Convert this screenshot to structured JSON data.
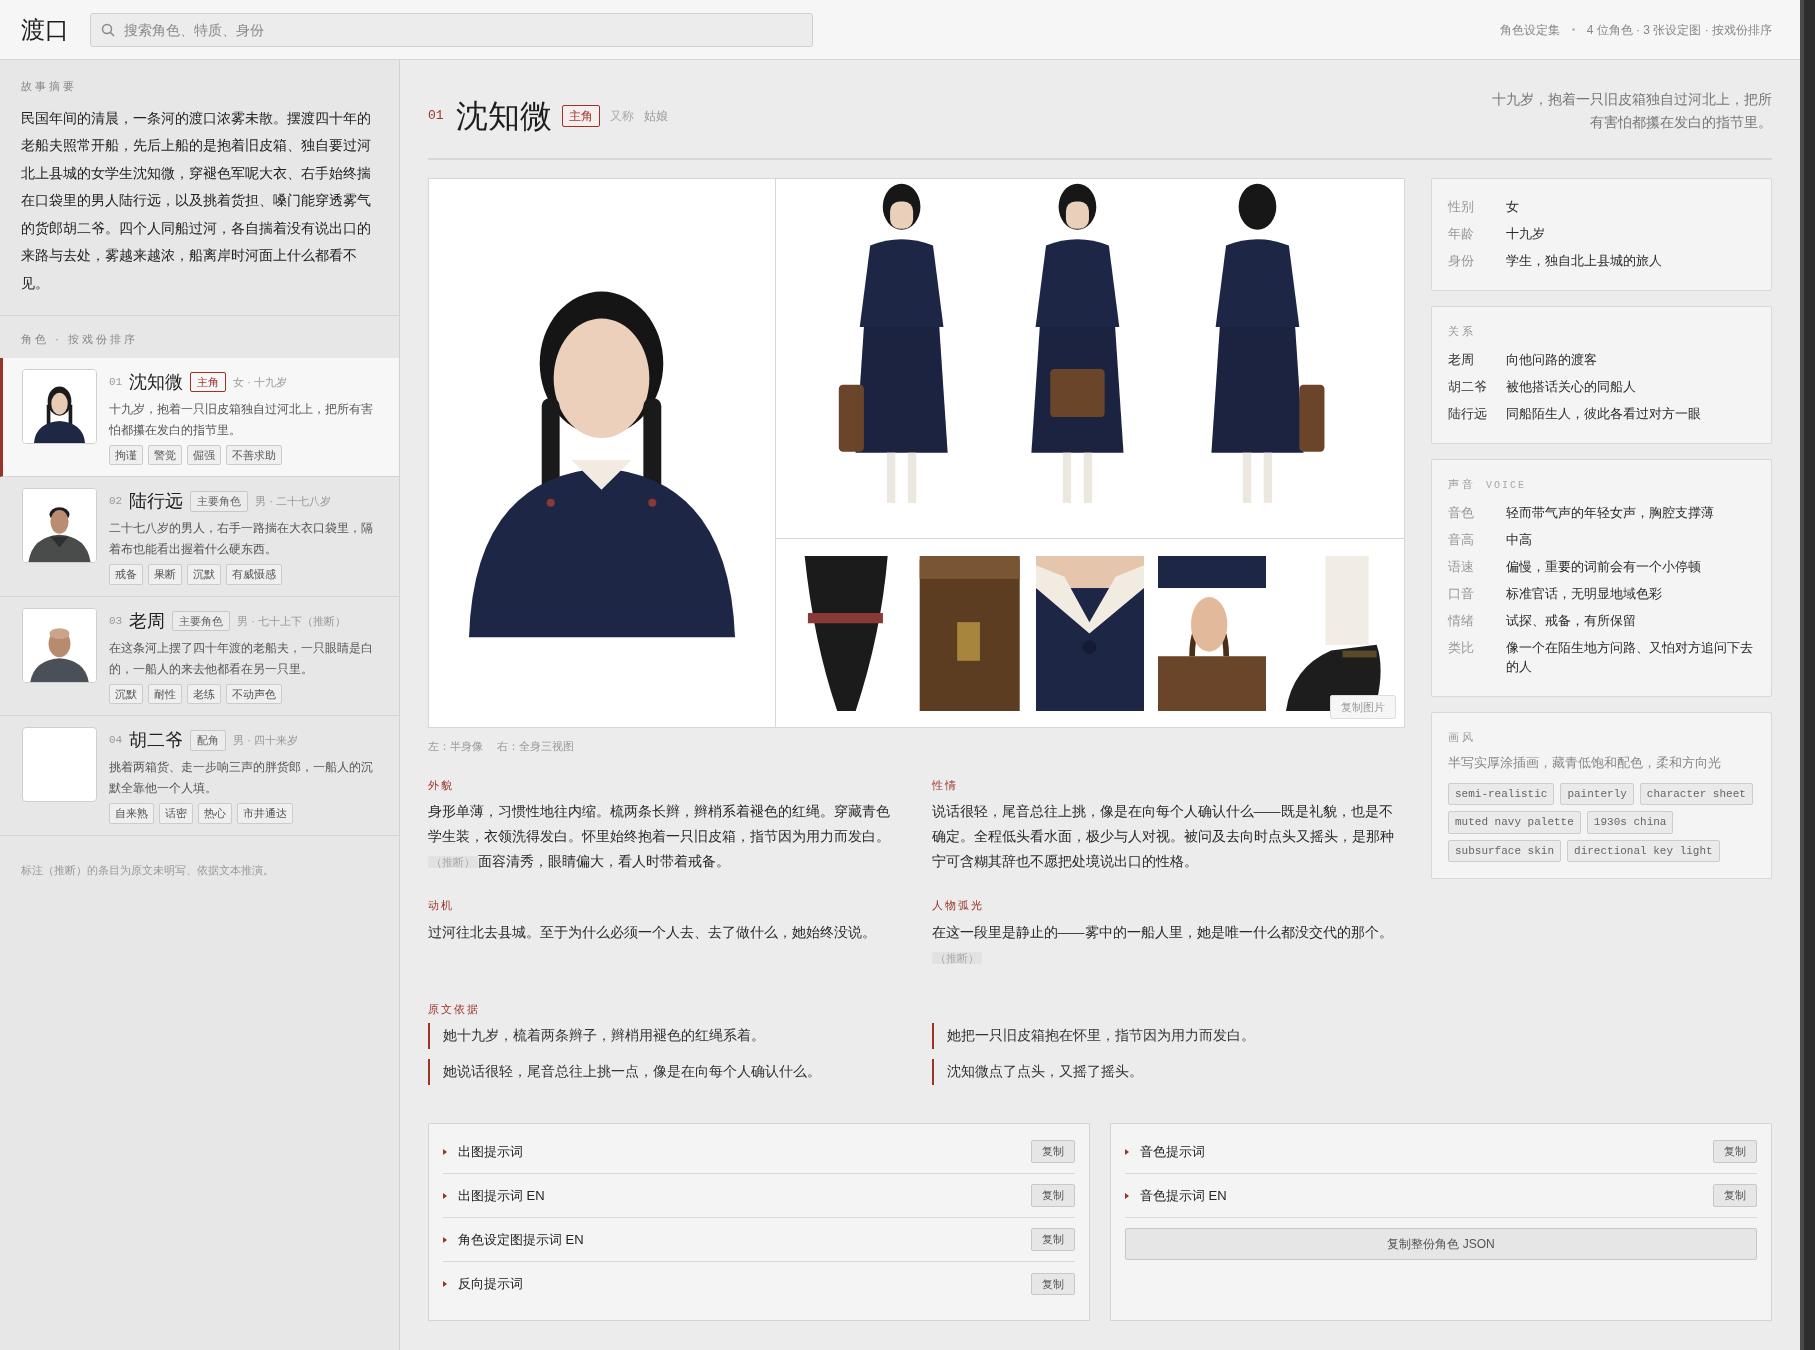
{
  "app": {
    "title": "渡口",
    "search": {
      "placeholder": "搜索角色、特质、身份"
    },
    "collection": "角色设定集",
    "meta": "4 位角色 · 3 张设定图 · 按戏份排序"
  },
  "sidebar": {
    "summary_label": "故事摘要",
    "summary": "民国年间的清晨，一条河的渡口浓雾未散。摆渡四十年的老船夫照常开船，先后上船的是抱着旧皮箱、独自要过河北上县城的女学生沈知微，穿褪色军呢大衣、右手始终揣在口袋里的男人陆行远，以及挑着货担、嗓门能穿透雾气的货郎胡二爷。四个人同船过河，各自揣着没有说出口的来路与去处，雾越来越浓，船离岸时河面上什么都看不见。",
    "list_label": "角色 · 按戏份排序",
    "characters": [
      {
        "number": "01",
        "name": "沈知微",
        "role": "主角",
        "kind": "lead",
        "meta": "女 · 十九岁",
        "description": "十九岁，抱着一只旧皮箱独自过河北上，把所有害怕都攥在发白的指节里。",
        "tags": [
          "拘谨",
          "警觉",
          "倔强",
          "不善求助"
        ],
        "avatar": {
          "kind": "picture"
        },
        "selected": true
      },
      {
        "number": "02",
        "name": "陆行远",
        "role": "主要角色",
        "kind": "major",
        "meta": "男 · 二十七八岁",
        "description": "二十七八岁的男人，右手一路揣在大衣口袋里，隔着布也能看出握着什么硬东西。",
        "tags": [
          "戒备",
          "果断",
          "沉默",
          "有威慑感"
        ],
        "avatar": {
          "kind": "picture"
        },
        "selected": false
      },
      {
        "number": "03",
        "name": "老周",
        "role": "主要角色",
        "kind": "major",
        "meta": "男 · 七十上下（推断）",
        "description": "在这条河上摆了四十年渡的老船夫，一只眼睛是白的，一船人的来去他都看在另一只里。",
        "tags": [
          "沉默",
          "耐性",
          "老练",
          "不动声色"
        ],
        "avatar": {
          "kind": "picture"
        },
        "selected": false
      },
      {
        "number": "04",
        "name": "胡二爷",
        "role": "配角",
        "kind": "minor",
        "meta": "男 · 四十来岁",
        "description": "挑着两箱货、走一步响三声的胖货郎，一船人的沉默全靠他一个人填。",
        "tags": [
          "自来熟",
          "话密",
          "热心",
          "市井通达"
        ],
        "selected": false
      }
    ],
    "footnote": "标注（推断）的条目为原文未明写、依据文本推演。"
  },
  "detail": {
    "number": "01",
    "name": "沈知微",
    "role": "主角",
    "kind": "lead",
    "alias_label": "又称",
    "alias": "姑娘",
    "summary": "十九岁，抱着一只旧皮箱独自过河北上，把所有害怕都攥在发白的指节里。",
    "sheet": {
      "half_body": {
        "kind": "picture"
      },
      "turnaround": {
        "kind": "picture"
      },
      "details": [
        {
          "kind": "picture"
        },
        {
          "kind": "picture"
        },
        {
          "kind": "picture"
        },
        {
          "kind": "picture"
        },
        {
          "kind": "picture"
        }
      ],
      "copy_button": "复制图片"
    },
    "captions": [
      "左：半身像",
      "右：全身三视图"
    ],
    "sections": [
      {
        "title": "外貌",
        "segments": [
          {
            "kind": "text",
            "text": "身形单薄，习惯性地往内缩。梳两条长辫，辫梢系着褪色的红绳。穿藏青色学生装，衣领洗得发白。怀里始终抱着一只旧皮箱，指节因为用力而发白。"
          },
          {
            "kind": "inferred",
            "text": "（推断）"
          },
          {
            "kind": "text",
            "text": "面容清秀，眼睛偏大，看人时带着戒备。"
          }
        ]
      },
      {
        "title": "性情",
        "segments": [
          {
            "kind": "text",
            "text": "说话很轻，尾音总往上挑，像是在向每个人确认什么——既是礼貌，也是不确定。全程低头看水面，极少与人对视。被问及去向时点头又摇头，是那种宁可含糊其辞也不愿把处境说出口的性格。"
          }
        ]
      },
      {
        "title": "动机",
        "segments": [
          {
            "kind": "text",
            "text": "过河往北去县城。至于为什么必须一个人去、去了做什么，她始终没说。"
          }
        ]
      },
      {
        "title": "人物弧光",
        "segments": [
          {
            "kind": "text",
            "text": "在这一段里是静止的——雾中的一船人里，她是唯一什么都没交代的那个。"
          },
          {
            "kind": "inferred",
            "text": "（推断）"
          }
        ]
      }
    ],
    "sources": {
      "title": "原文依据",
      "quotes": [
        "她十九岁，梳着两条辫子，辫梢用褪色的红绳系着。",
        "她把一只旧皮箱抱在怀里，指节因为用力而发白。",
        "她说话很轻，尾音总往上挑一点，像是在向每个人确认什么。",
        "沈知微点了点头，又摇了摇头。"
      ]
    },
    "prompts": {
      "left": [
        {
          "label": "出图提示词",
          "button": "复制"
        },
        {
          "label": "出图提示词 EN",
          "button": "复制"
        },
        {
          "label": "角色设定图提示词 EN",
          "button": "复制"
        },
        {
          "label": "反向提示词",
          "button": "复制"
        }
      ],
      "right": [
        {
          "label": "音色提示词",
          "button": "复制"
        },
        {
          "label": "音色提示词 EN",
          "button": "复制"
        }
      ],
      "json_button": "复制整份角色 JSON"
    }
  },
  "info": {
    "rows": [
      {
        "label": "性别",
        "value": "女"
      },
      {
        "label": "年龄",
        "value": "十九岁"
      },
      {
        "label": "身份",
        "value": "学生，独自北上县城的旅人"
      }
    ]
  },
  "relations": {
    "title": "关系",
    "rows": [
      {
        "label": "老周",
        "value": "向他问路的渡客"
      },
      {
        "label": "胡二爷",
        "value": "被他搭话关心的同船人"
      },
      {
        "label": "陆行远",
        "value": "同船陌生人，彼此各看过对方一眼"
      }
    ]
  },
  "voice": {
    "title": "声音",
    "subtitle": "VOICE",
    "rows": [
      {
        "label": "音色",
        "value": "轻而带气声的年轻女声，胸腔支撑薄"
      },
      {
        "label": "音高",
        "value": "中高"
      },
      {
        "label": "语速",
        "value": "偏慢，重要的词前会有一个小停顿"
      },
      {
        "label": "口音",
        "value": "标准官话，无明显地域色彩"
      },
      {
        "label": "情绪",
        "value": "试探、戒备，有所保留"
      },
      {
        "label": "类比",
        "value": "像一个在陌生地方问路、又怕对方追问下去的人"
      }
    ]
  },
  "style": {
    "title": "画风",
    "description": "半写实厚涂插画，藏青低饱和配色，柔和方向光",
    "tags": [
      "semi-realistic",
      "painterly",
      "character sheet",
      "muted navy palette",
      "1930s china",
      "subsurface skin",
      "directional key light"
    ]
  }
}
